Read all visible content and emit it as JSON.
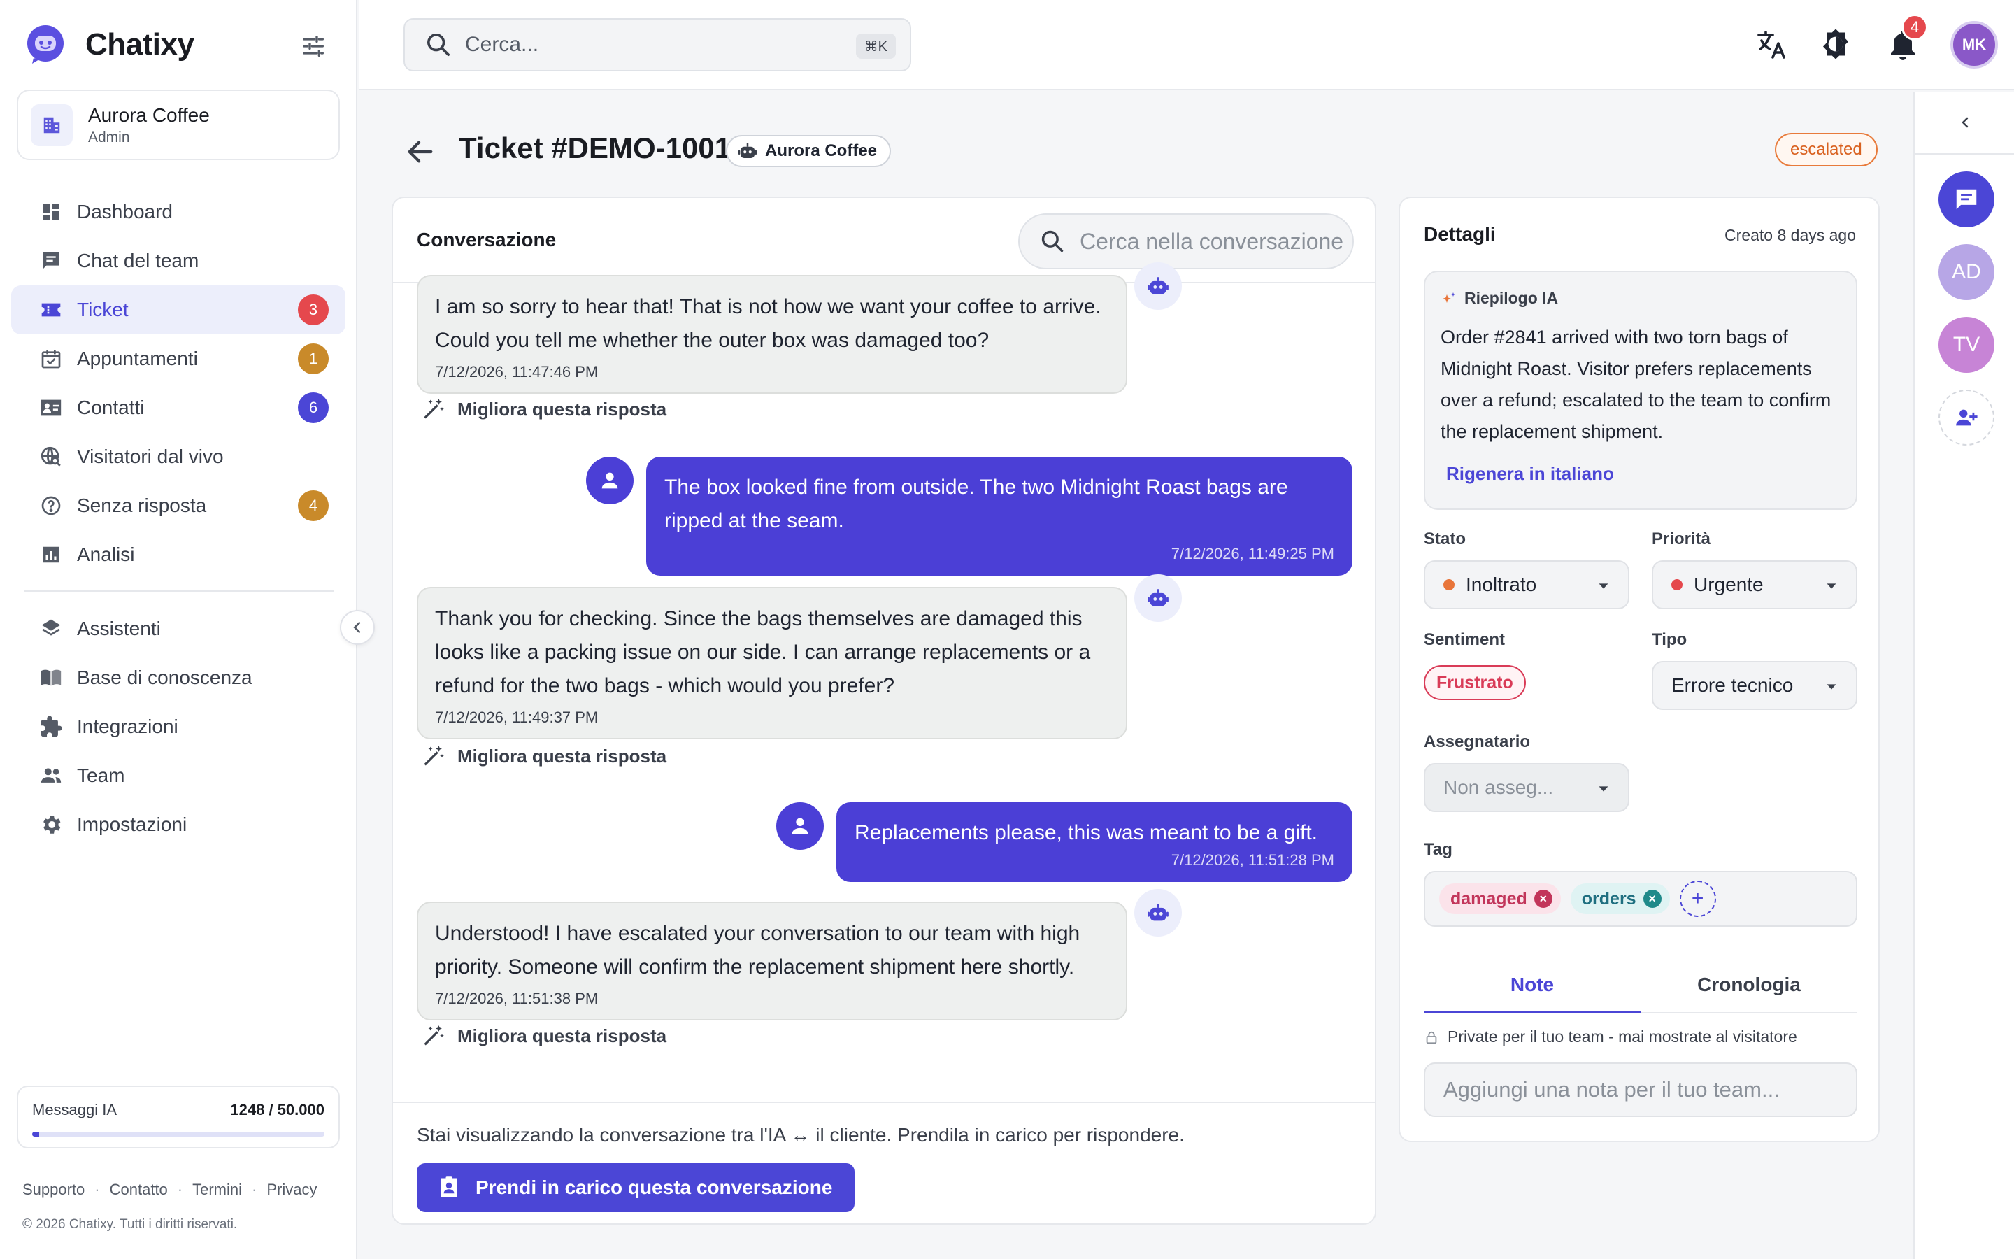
{
  "app": {
    "name": "Chatixy"
  },
  "org": {
    "name": "Aurora Coffee",
    "role": "Admin"
  },
  "nav": {
    "items": [
      {
        "label": "Dashboard",
        "icon": "dashboard-icon"
      },
      {
        "label": "Chat del team",
        "icon": "chat-icon"
      },
      {
        "label": "Ticket",
        "icon": "ticket-icon",
        "badge": "3",
        "badge_color": "#e5484d",
        "active": true
      },
      {
        "label": "Appuntamenti",
        "icon": "calendar-icon",
        "badge": "1",
        "badge_color": "#c98a2a"
      },
      {
        "label": "Contatti",
        "icon": "contacts-icon",
        "badge": "6",
        "badge_color": "#4b46d6"
      },
      {
        "label": "Visitatori dal vivo",
        "icon": "live-visitors-icon"
      },
      {
        "label": "Senza risposta",
        "icon": "help-icon",
        "badge": "4",
        "badge_color": "#c98a2a"
      },
      {
        "label": "Analisi",
        "icon": "analytics-icon"
      }
    ],
    "secondary": [
      {
        "label": "Assistenti",
        "icon": "layers-icon"
      },
      {
        "label": "Base di conoscenza",
        "icon": "book-icon"
      },
      {
        "label": "Integrazioni",
        "icon": "puzzle-icon"
      },
      {
        "label": "Team",
        "icon": "team-icon"
      },
      {
        "label": "Impostazioni",
        "icon": "gear-icon"
      }
    ]
  },
  "usage": {
    "label": "Messaggi IA",
    "value": "1248 / 50.000",
    "fraction": 0.025
  },
  "footer": {
    "links": [
      "Supporto",
      "Contatto",
      "Termini",
      "Privacy"
    ],
    "copyright": "© 2026 Chatixy. Tutti i diritti riservati."
  },
  "topbar": {
    "search_placeholder": "Cerca...",
    "shortcut": "⌘K",
    "notifications": "4",
    "avatar": "MK"
  },
  "rail": {
    "avatars": [
      {
        "initials": "AD",
        "color": "#b7a6e6"
      },
      {
        "initials": "TV",
        "color": "#c784d6"
      }
    ]
  },
  "ticket": {
    "title": "Ticket #DEMO-1001",
    "org_chip": "Aurora Coffee",
    "status": "escalated"
  },
  "conversation": {
    "title": "Conversazione",
    "search_placeholder": "Cerca nella conversazione",
    "improve_label": "Migliora questa risposta",
    "messages": [
      {
        "role": "bot",
        "text": "I am so sorry to hear that! That is not how we want your coffee to arrive. Could you tell me whether the outer box was damaged too?",
        "time": "7/12/2026, 11:47:46 PM"
      },
      {
        "role": "user",
        "text": "The box looked fine from outside. The two Midnight Roast bags are ripped at the seam.",
        "time": "7/12/2026, 11:49:25 PM"
      },
      {
        "role": "bot",
        "text": "Thank you for checking. Since the bags themselves are damaged this looks like a packing issue on our side. I can arrange replacements or a refund for the two bags - which would you prefer?",
        "time": "7/12/2026, 11:49:37 PM"
      },
      {
        "role": "user",
        "text": "Replacements please, this was meant to be a gift.",
        "time": "7/12/2026, 11:51:28 PM"
      },
      {
        "role": "bot",
        "text": "Understood! I have escalated your conversation to our team with high priority. Someone will confirm the replacement shipment here shortly.",
        "time": "7/12/2026, 11:51:38 PM"
      }
    ],
    "footer_note": "Stai visualizzando la conversazione tra l'IA ↔ il cliente. Prendila in carico per rispondere.",
    "takeover_label": "Prendi in carico questa conversazione"
  },
  "details": {
    "title": "Dettagli",
    "created": "Creato 8 days ago",
    "ai_summary": {
      "label": "Riepilogo IA",
      "text": "Order #2841 arrived with two torn bags of Midnight Roast. Visitor prefers replacements over a refund; escalated to the team to confirm the replacement shipment.",
      "regen": "Rigenera in italiano"
    },
    "status": {
      "label": "Stato",
      "value": "Inoltrato",
      "color": "#e8753a"
    },
    "priority": {
      "label": "Priorità",
      "value": "Urgente",
      "color": "#e5484d"
    },
    "sentiment": {
      "label": "Sentiment",
      "value": "Frustrato"
    },
    "type": {
      "label": "Tipo",
      "value": "Errore tecnico"
    },
    "assignee": {
      "label": "Assegnatario",
      "value": "Non asseg..."
    },
    "tags": {
      "label": "Tag",
      "items": [
        {
          "label": "damaged",
          "color": "#c2355a",
          "bg": "#fbe3ea"
        },
        {
          "label": "orders",
          "color": "#1f8a8a",
          "bg": "#dff3f3"
        }
      ]
    },
    "tabs": [
      "Note",
      "Cronologia"
    ],
    "private_note": "Private per il tuo team - mai mostrate al visitatore",
    "note_placeholder": "Aggiungi una nota per il tuo team..."
  }
}
